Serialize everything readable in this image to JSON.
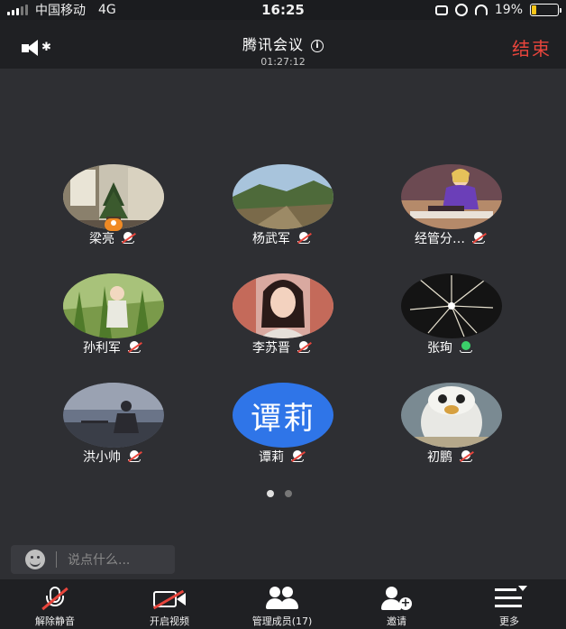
{
  "status_bar": {
    "carrier": "中国移动",
    "network": "4G",
    "time": "16:25",
    "battery_percent": "19%",
    "battery_level": 0.19,
    "battery_color": "#f5c518",
    "icons": [
      "signal-icon",
      "lock-rotation-icon",
      "alarm-icon",
      "headphones-icon",
      "battery-icon"
    ]
  },
  "header": {
    "speaker_icon": "speaker-bluetooth-icon",
    "bluetooth_glyph": "✱",
    "title": "腾讯会议",
    "info_glyph": "i",
    "elapsed": "01:27:12",
    "end_label": "结束",
    "end_color": "#e8453c"
  },
  "participants": [
    {
      "name": "梁亮",
      "mic": "muted",
      "host": true,
      "avatar": "photo-plant-window"
    },
    {
      "name": "杨武军",
      "mic": "muted",
      "host": false,
      "avatar": "photo-landscape"
    },
    {
      "name": "经管分…",
      "mic": "muted",
      "host": false,
      "avatar": "photo-woman-purple"
    },
    {
      "name": "孙利军",
      "mic": "muted",
      "host": false,
      "avatar": "photo-cornfield"
    },
    {
      "name": "李苏晋",
      "mic": "muted",
      "host": false,
      "avatar": "photo-woman-portrait"
    },
    {
      "name": "张珣",
      "mic": "on",
      "host": false,
      "avatar": "photo-fireworks"
    },
    {
      "name": "洪小帅",
      "mic": "muted",
      "host": false,
      "avatar": "photo-silhouette-dusk"
    },
    {
      "name": "谭莉",
      "mic": "muted",
      "host": false,
      "avatar_text": "谭莉",
      "avatar_color": "#2f75e8"
    },
    {
      "name": "初鹏",
      "mic": "muted",
      "host": false,
      "avatar": "photo-penguin"
    }
  ],
  "pager": {
    "pages": 2,
    "current": 1
  },
  "chat": {
    "placeholder": "说点什么..."
  },
  "toolbar": {
    "unmute": "解除静音",
    "start_video": "开启视频",
    "manage_members": "管理成员(17)",
    "invite": "邀请",
    "more": "更多",
    "invite_plus": "+"
  }
}
